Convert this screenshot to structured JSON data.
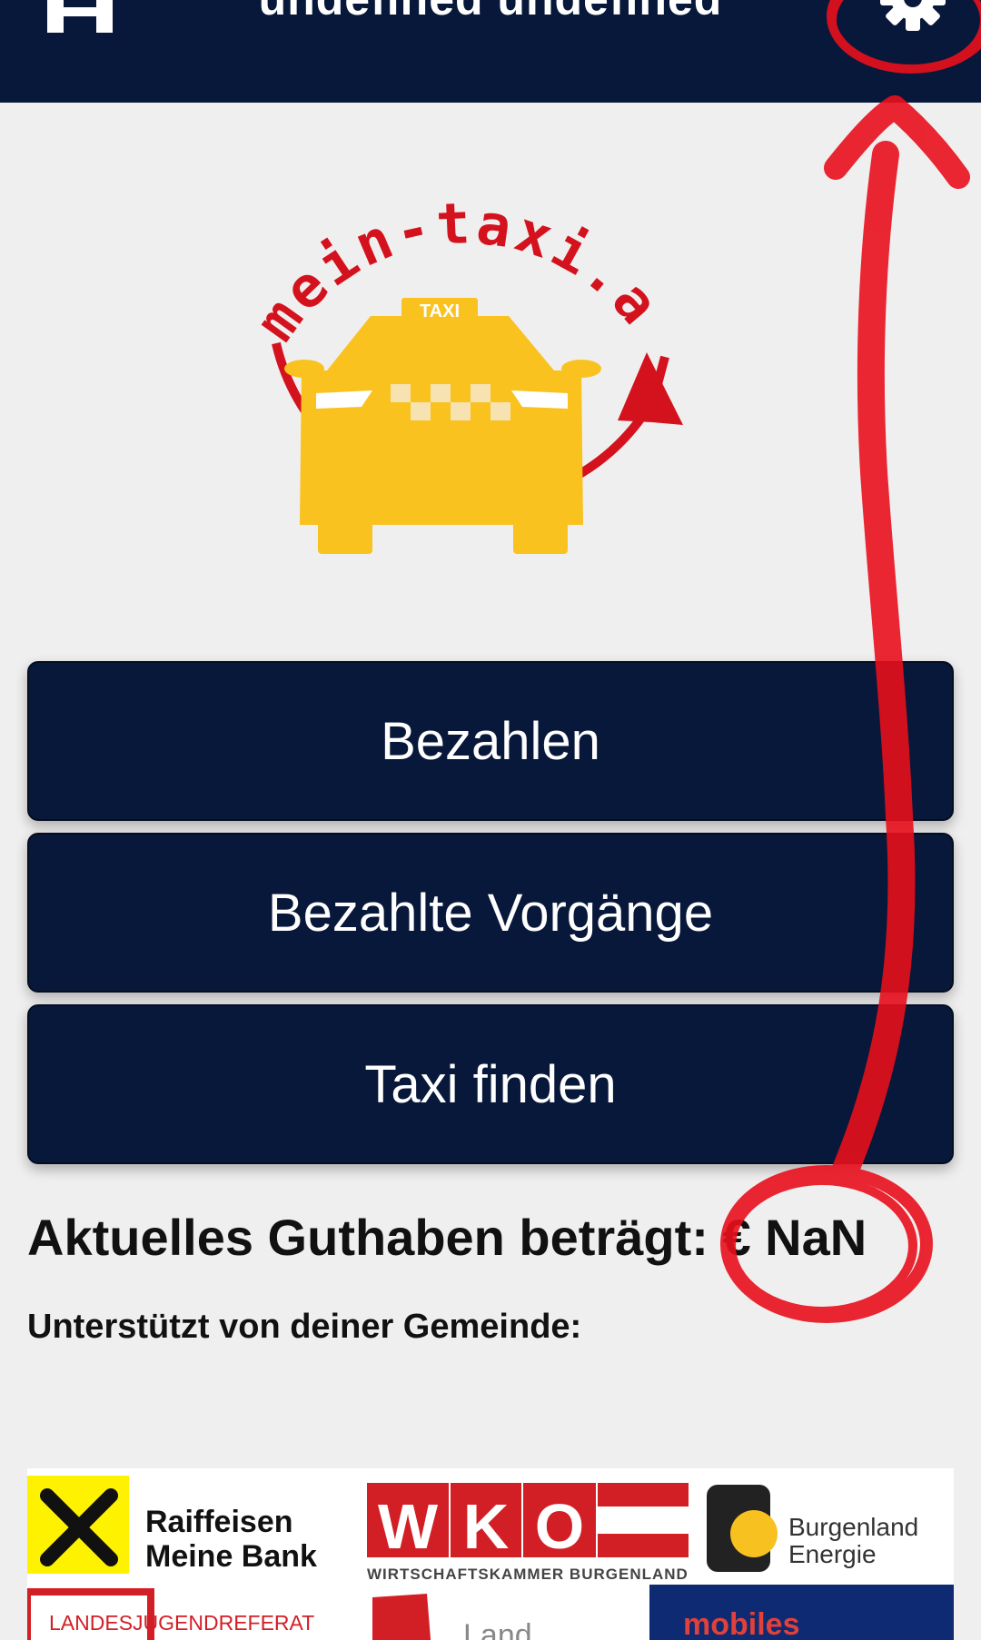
{
  "header": {
    "title": "undefined undefined",
    "home_icon": "home-icon",
    "settings_icon": "gear-icon",
    "background": "#08183a"
  },
  "logo": {
    "arc_text": "mein-taxi.at",
    "roof_sign": "TAXI",
    "colors": {
      "red": "#d4121e",
      "yellow": "#f9c21f"
    }
  },
  "actions": {
    "pay": "Bezahlen",
    "paid_transactions": "Bezahlte Vorgänge",
    "find_taxi": "Taxi finden"
  },
  "balance": {
    "label": "Aktuelles Guthaben beträgt:",
    "value": "€ NaN"
  },
  "sponsors": {
    "heading": "Unterstützt von deiner Gemeinde:",
    "raiffeisen_line1": "Raiffeisen",
    "raiffeisen_line2": "Meine Bank",
    "wko_letters": [
      "W",
      "K",
      "O"
    ],
    "wko_sub": "WIRTSCHAFTSKAMMER BURGENLAND",
    "energie_line1": "Burgenland",
    "energie_line2": "Energie",
    "ljr": "LANDESJUGENDREFERAT",
    "land": "Land",
    "mobiles": "mobiles"
  },
  "annotation_color": "#e8101c"
}
